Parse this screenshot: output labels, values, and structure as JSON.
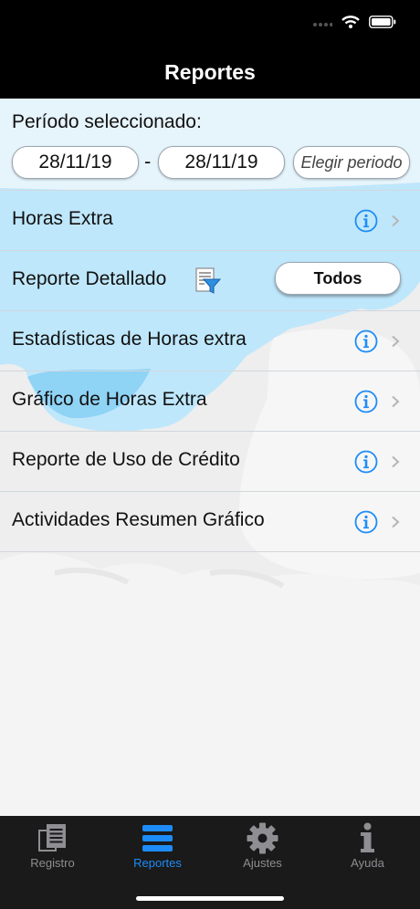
{
  "nav": {
    "title": "Reportes"
  },
  "period": {
    "label": "Período seleccionado:",
    "start_date": "28/11/19",
    "separator": "-",
    "end_date": "28/11/19",
    "choose_label": "Elegir periodo"
  },
  "rows": [
    {
      "label": "Horas Extra",
      "icons": [
        "info-icon",
        "chevron-right-icon"
      ]
    },
    {
      "label": "Reporte Detallado",
      "icons": [
        "filter-report-icon"
      ],
      "selector": "Todos"
    },
    {
      "label": "Estadísticas de Horas extra",
      "icons": [
        "info-icon",
        "chevron-right-icon"
      ]
    },
    {
      "label": "Gráfico de Horas Extra",
      "icons": [
        "info-icon",
        "chevron-right-icon"
      ]
    },
    {
      "label": "Reporte de Uso de Crédito",
      "icons": [
        "info-icon",
        "chevron-right-icon"
      ]
    },
    {
      "label": "Actividades Resumen Gráfico",
      "icons": [
        "info-icon",
        "chevron-right-icon"
      ]
    }
  ],
  "tabs": [
    {
      "label": "Registro",
      "icon": "document-icon",
      "active": false
    },
    {
      "label": "Reportes",
      "icon": "list-icon",
      "active": true
    },
    {
      "label": "Ajustes",
      "icon": "gear-icon",
      "active": false
    },
    {
      "label": "Ayuda",
      "icon": "info-icon",
      "active": false
    }
  ],
  "colors": {
    "accent": "#1d8cf8",
    "sky": "#bfe7fb",
    "background": "#eeeeee",
    "bars": "#000000",
    "tab_bar": "#1a1a1a"
  }
}
